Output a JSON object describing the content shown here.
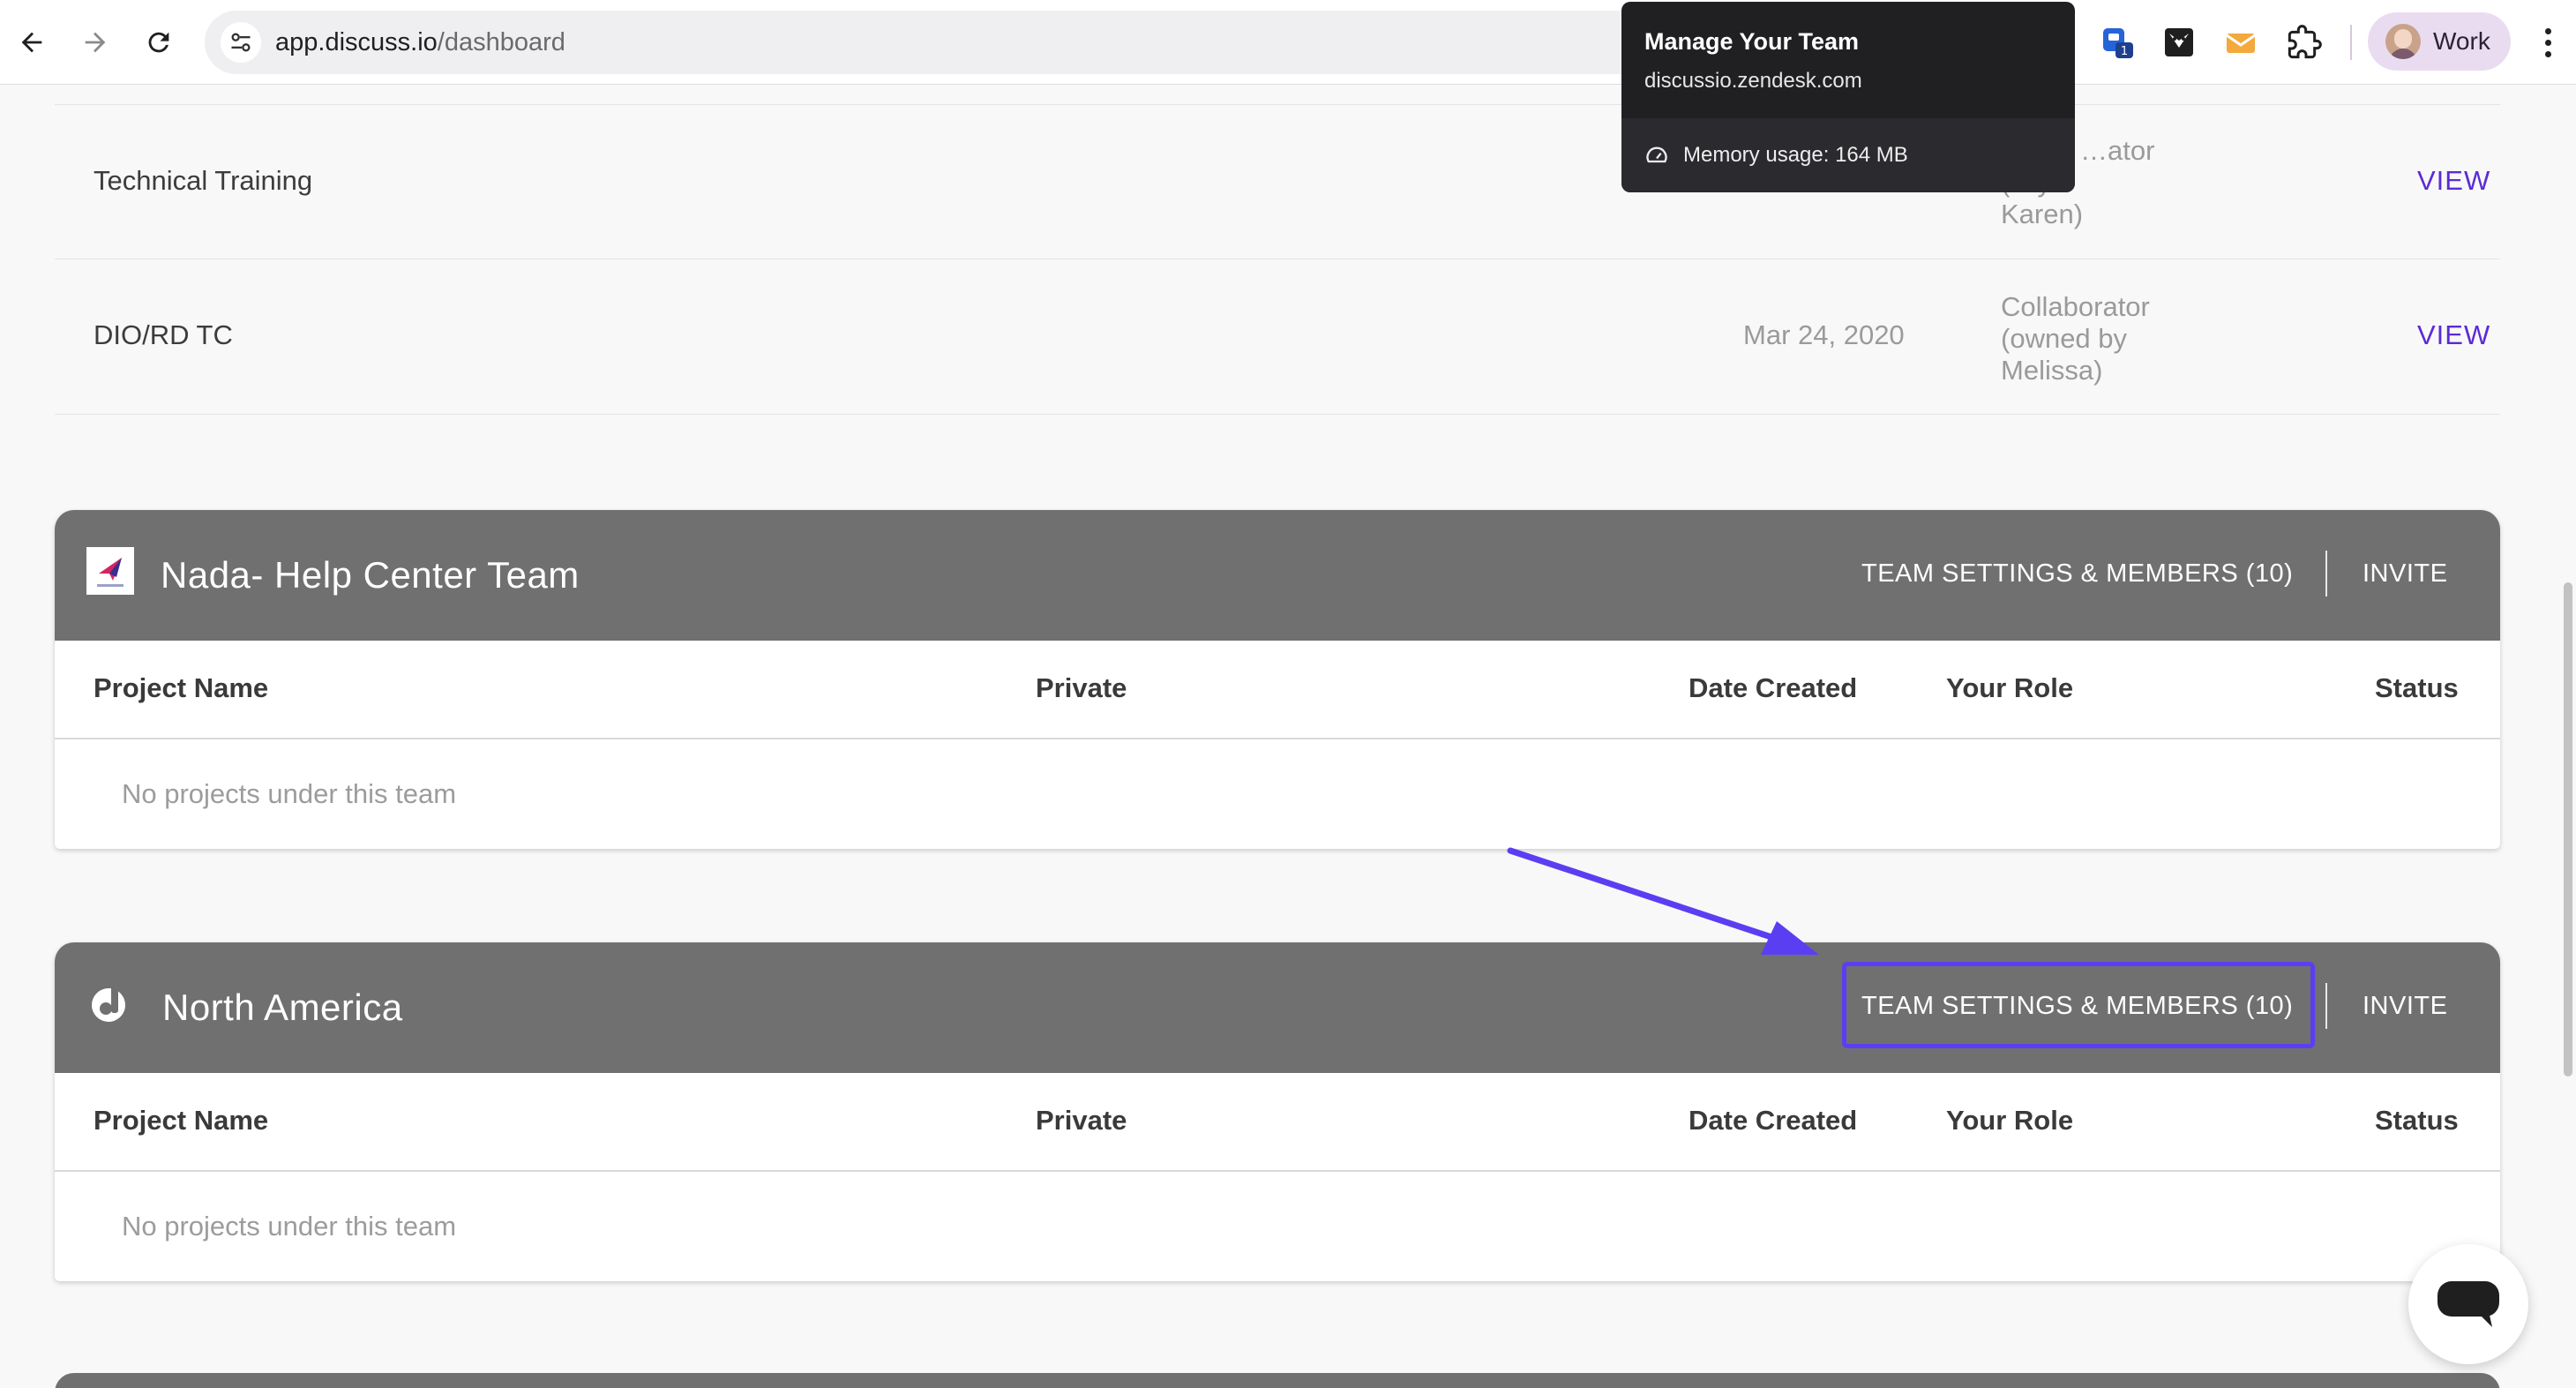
{
  "browser": {
    "url_host": "app.discuss.io",
    "url_path": "/dashboard",
    "profile_label": "Work",
    "extension_badge": "1"
  },
  "hovercard": {
    "title": "Manage Your Team",
    "domain": "discussio.zendesk.com",
    "memory": "Memory usage: 164 MB"
  },
  "projects": [
    {
      "name": "Technical Training",
      "date": "",
      "role_lines": [
        "…ator",
        "(…y",
        "Karen)"
      ],
      "action": "VIEW"
    },
    {
      "name": "DIO/RD TC",
      "date": "Mar 24, 2020",
      "role_lines": [
        "Collaborator",
        "(owned by",
        "Melissa)"
      ],
      "action": "VIEW"
    }
  ],
  "columns": {
    "project_name": "Project Name",
    "private": "Private",
    "date_created": "Date Created",
    "your_role": "Your Role",
    "status": "Status"
  },
  "teams": [
    {
      "name": "Nada- Help Center Team",
      "settings_label": "TEAM SETTINGS & MEMBERS (10)",
      "invite_label": "INVITE",
      "empty_text": "No projects under this team"
    },
    {
      "name": "North America",
      "settings_label": "TEAM SETTINGS & MEMBERS (10)",
      "invite_label": "INVITE",
      "empty_text": "No projects under this team"
    }
  ],
  "colors": {
    "accent": "#5b2bd6",
    "annotation": "#5a3ff2",
    "team_header": "#707070"
  }
}
